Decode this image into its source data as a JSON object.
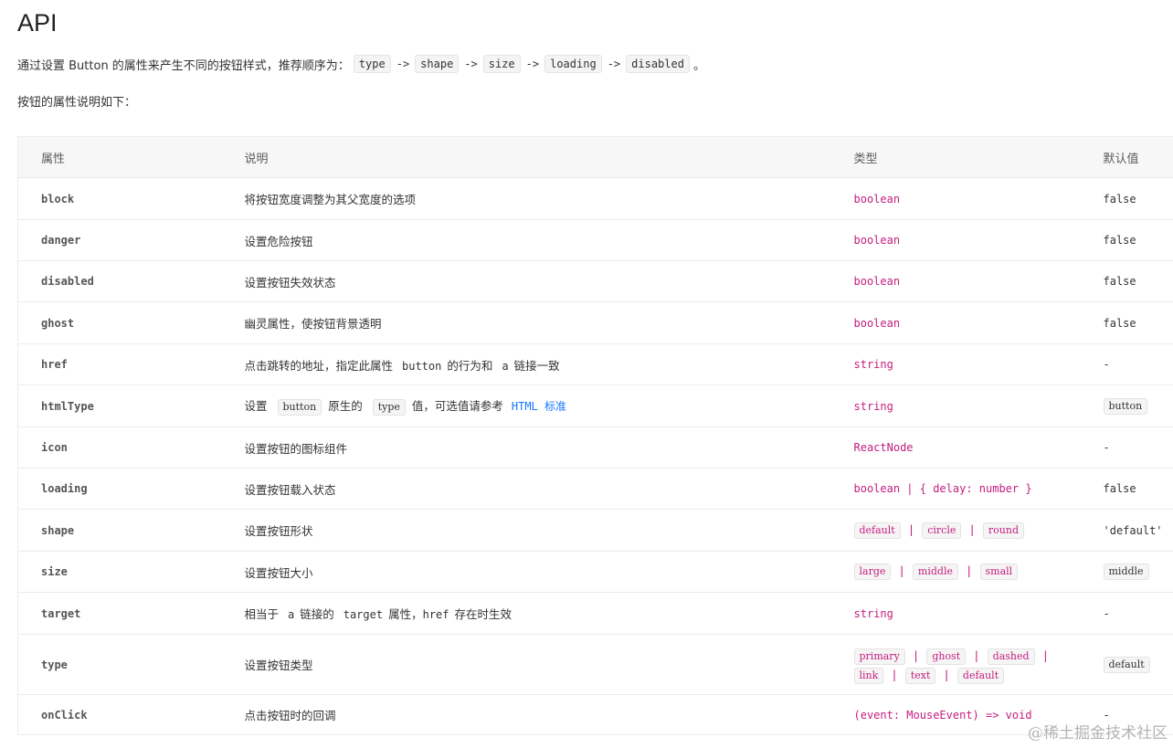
{
  "page": {
    "title": "API",
    "intro_text": "通过设置 Button 的属性来产生不同的按钮样式，推荐顺序为：",
    "intro_order": [
      "type",
      "shape",
      "size",
      "loading",
      "disabled"
    ],
    "intro_arrow": "->",
    "intro_end": "。",
    "subintro": "按钮的属性说明如下："
  },
  "table": {
    "headers": [
      "属性",
      "说明",
      "类型",
      "默认值"
    ],
    "rows": [
      {
        "name": "block",
        "desc": "将按钮宽度调整为其父宽度的选项",
        "type": "boolean",
        "default": "false"
      },
      {
        "name": "danger",
        "desc": "设置危险按钮",
        "type": "boolean",
        "default": "false"
      },
      {
        "name": "disabled",
        "desc": "设置按钮失效状态",
        "type": "boolean",
        "default": "false"
      },
      {
        "name": "ghost",
        "desc": "幽灵属性，使按钮背景透明",
        "type": "boolean",
        "default": "false"
      },
      {
        "name": "href",
        "desc_1": "点击跳转的地址，指定此属性",
        "desc_code_1": "button",
        "desc_2": "的行为和",
        "desc_code_2": "a",
        "desc_3": "链接一致",
        "type": "string",
        "default": "-"
      },
      {
        "name": "htmlType",
        "desc_1": "设置",
        "desc_tag_1": "button",
        "desc_2": "原生的",
        "desc_tag_2": "type",
        "desc_3": "值，可选值请参考",
        "desc_link": "HTML 标准",
        "type": "string",
        "default": "button"
      },
      {
        "name": "icon",
        "desc": "设置按钮的图标组件",
        "type": "ReactNode",
        "default": "-"
      },
      {
        "name": "loading",
        "desc": "设置按钮载入状态",
        "type": "boolean | { delay: number }",
        "default": "false"
      },
      {
        "name": "shape",
        "desc": "设置按钮形状",
        "type_options": [
          "default",
          "circle",
          "round"
        ],
        "type_sep": "|",
        "default": "'default'"
      },
      {
        "name": "size",
        "desc": "设置按钮大小",
        "type_options": [
          "large",
          "middle",
          "small"
        ],
        "default": "middle"
      },
      {
        "name": "target",
        "desc_1": "相当于",
        "desc_code_1": "a",
        "desc_2": "链接的",
        "desc_code_2": "target",
        "desc_3": "属性，",
        "desc_code_3": "href",
        "desc_4": "存在时生效",
        "type": "string",
        "default": "-"
      },
      {
        "name": "type",
        "desc": "设置按钮类型",
        "type_options": [
          "primary",
          "ghost",
          "dashed",
          "link",
          "text",
          "default"
        ],
        "default": "default"
      },
      {
        "name": "onClick",
        "desc": "点击按钮时的回调",
        "type": "(event: MouseEvent) => void",
        "default": "-"
      }
    ]
  },
  "watermark": "@稀土掘金技术社区",
  "colors": {
    "type_text": "#c41d7f",
    "link": "#1677ff",
    "header_bg": "#f7f7f7"
  }
}
